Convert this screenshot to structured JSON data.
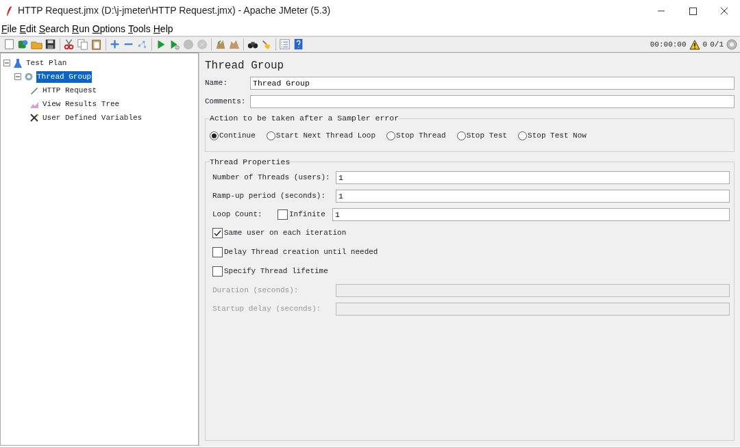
{
  "window": {
    "title": "HTTP Request.jmx (D:\\j-jmeter\\HTTP Request.jmx) - Apache JMeter (5.3)"
  },
  "menu": [
    "File",
    "Edit",
    "Search",
    "Run",
    "Options",
    "Tools",
    "Help"
  ],
  "toolbar": [
    {
      "disabled": false
    },
    {
      "disabled": false
    },
    {
      "disabled": false
    },
    {
      "disabled": false
    },
    {
      "disabled": false
    },
    {
      "disabled": false
    },
    {
      "disabled": false
    },
    {
      "disabled": false
    },
    {
      "disabled": false
    },
    {
      "disabled": false
    },
    {
      "disabled": false
    },
    {
      "disabled": false
    },
    {
      "disabled": true
    },
    {
      "disabled": true
    },
    {
      "disabled": false
    },
    {
      "disabled": false
    },
    {
      "disabled": false
    },
    {
      "disabled": false
    },
    {
      "disabled": false
    },
    {
      "disabled": false
    }
  ],
  "status": {
    "elapsed": "00:00:00",
    "warnings": "0",
    "threads": "0/1"
  },
  "tree": [
    {
      "label": "Test Plan",
      "expanded": true,
      "selected": false,
      "children": [
        {
          "label": "Thread Group",
          "expanded": true,
          "selected": true,
          "children": [
            {
              "label": "HTTP Request",
              "selected": false
            },
            {
              "label": "View Results Tree",
              "selected": false
            },
            {
              "label": "User Defined Variables",
              "selected": false
            }
          ]
        }
      ]
    }
  ],
  "panel": {
    "title": "Thread Group",
    "fields": [
      {
        "label": "Name:",
        "value": "Thread Group"
      },
      {
        "label": "Comments:"
      }
    ],
    "error_action": {
      "legend": "Action to be taken after a Sampler error",
      "options": [
        {
          "label": "Continue",
          "selected": true
        },
        {
          "label": "Start Next Thread Loop",
          "selected": false
        },
        {
          "label": "Stop Thread",
          "selected": false
        },
        {
          "label": "Stop Test",
          "selected": false
        },
        {
          "label": "Stop Test Now",
          "selected": false
        }
      ]
    },
    "thread_properties": {
      "legend": "Thread Properties",
      "rows": [
        {
          "kind": "field",
          "label": "Number of Threads (users):",
          "value": "1",
          "disabled": false
        },
        {
          "kind": "field",
          "label": "Ramp-up period (seconds):",
          "value": "1",
          "disabled": false
        },
        {
          "kind": "loop",
          "label": "Loop Count:",
          "option": "Infinite",
          "checked": false,
          "value": "1",
          "disabled": false
        },
        {
          "kind": "check",
          "label": "Same user on each iteration",
          "checked": true
        },
        {
          "kind": "check",
          "label": "Delay Thread creation until needed",
          "checked": false
        },
        {
          "kind": "check",
          "label": "Specify Thread lifetime",
          "checked": false
        },
        {
          "kind": "field",
          "label": "Duration (seconds):",
          "disabled": true
        },
        {
          "kind": "field",
          "label": "Startup delay (seconds):",
          "disabled": true
        }
      ]
    }
  }
}
